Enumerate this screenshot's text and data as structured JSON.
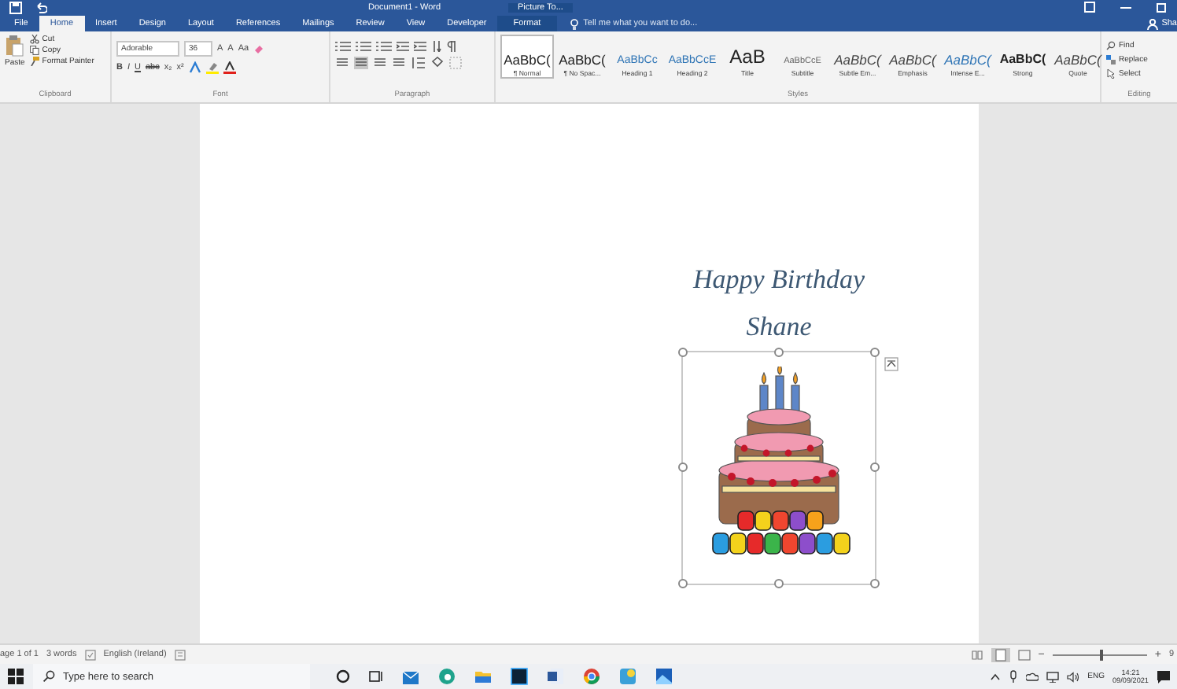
{
  "window": {
    "title": "Document1 - Word",
    "context_tab": "Picture To..."
  },
  "tabs": [
    {
      "label": "File",
      "selected": false
    },
    {
      "label": "Home",
      "selected": true
    },
    {
      "label": "Insert",
      "selected": false
    },
    {
      "label": "Design",
      "selected": false
    },
    {
      "label": "Layout",
      "selected": false
    },
    {
      "label": "References",
      "selected": false
    },
    {
      "label": "Mailings",
      "selected": false
    },
    {
      "label": "Review",
      "selected": false
    },
    {
      "label": "View",
      "selected": false
    },
    {
      "label": "Developer",
      "selected": false
    },
    {
      "label": "Format",
      "selected": false
    }
  ],
  "tell_me": {
    "placeholder": "Tell me what you want to do..."
  },
  "share": "Sha",
  "clipboard": {
    "paste": "Paste",
    "items": [
      "Cut",
      "Copy",
      "Format Painter"
    ],
    "label": "Clipboard"
  },
  "font": {
    "family": "Adorable",
    "size": "36",
    "size_buttons": [
      "A",
      "A",
      "Aa"
    ],
    "format_buttons": [
      "B",
      "I",
      "U",
      "abc",
      "x₂",
      "x²"
    ],
    "label": "Font"
  },
  "paragraph": {
    "label": "Paragraph"
  },
  "styles": {
    "label": "Styles",
    "items": [
      {
        "preview": "AaBbC(",
        "name": "¶ Normal",
        "selected": true
      },
      {
        "preview": "AaBbC(",
        "name": "¶ No Spac...",
        "selected": false
      },
      {
        "preview": "AaBbCc",
        "name": "Heading 1",
        "selected": false
      },
      {
        "preview": "AaBbCcE",
        "name": "Heading 2",
        "selected": false
      },
      {
        "preview": "AaB",
        "name": "Title",
        "selected": false
      },
      {
        "preview": "AaBbCcE",
        "name": "Subtitle",
        "selected": false
      },
      {
        "preview": "AaBbC(",
        "name": "Subtle Em...",
        "selected": false
      },
      {
        "preview": "AaBbC(",
        "name": "Emphasis",
        "selected": false
      },
      {
        "preview": "AaBbC(",
        "name": "Intense E...",
        "selected": false
      },
      {
        "preview": "AaBbC(",
        "name": "Strong",
        "selected": false
      },
      {
        "preview": "AaBbC(",
        "name": "Quote",
        "selected": false
      }
    ]
  },
  "editing": {
    "label": "Editing",
    "items": [
      "Find",
      "Replace",
      "Select"
    ]
  },
  "document": {
    "lines": [
      "Happy Birthday",
      "Shane"
    ]
  },
  "status_bar": {
    "page": "age 1 of 1",
    "words": "3 words",
    "language": "English (Ireland)",
    "zoom_out": "−",
    "zoom": {
      "level": 0.5
    },
    "zoom_in": "+",
    "zoom_reading": "9"
  },
  "taskbar": {
    "search": {
      "placeholder": "Type here to search"
    },
    "language": "ENG",
    "time": "14:21",
    "date": "09/09/2021"
  }
}
